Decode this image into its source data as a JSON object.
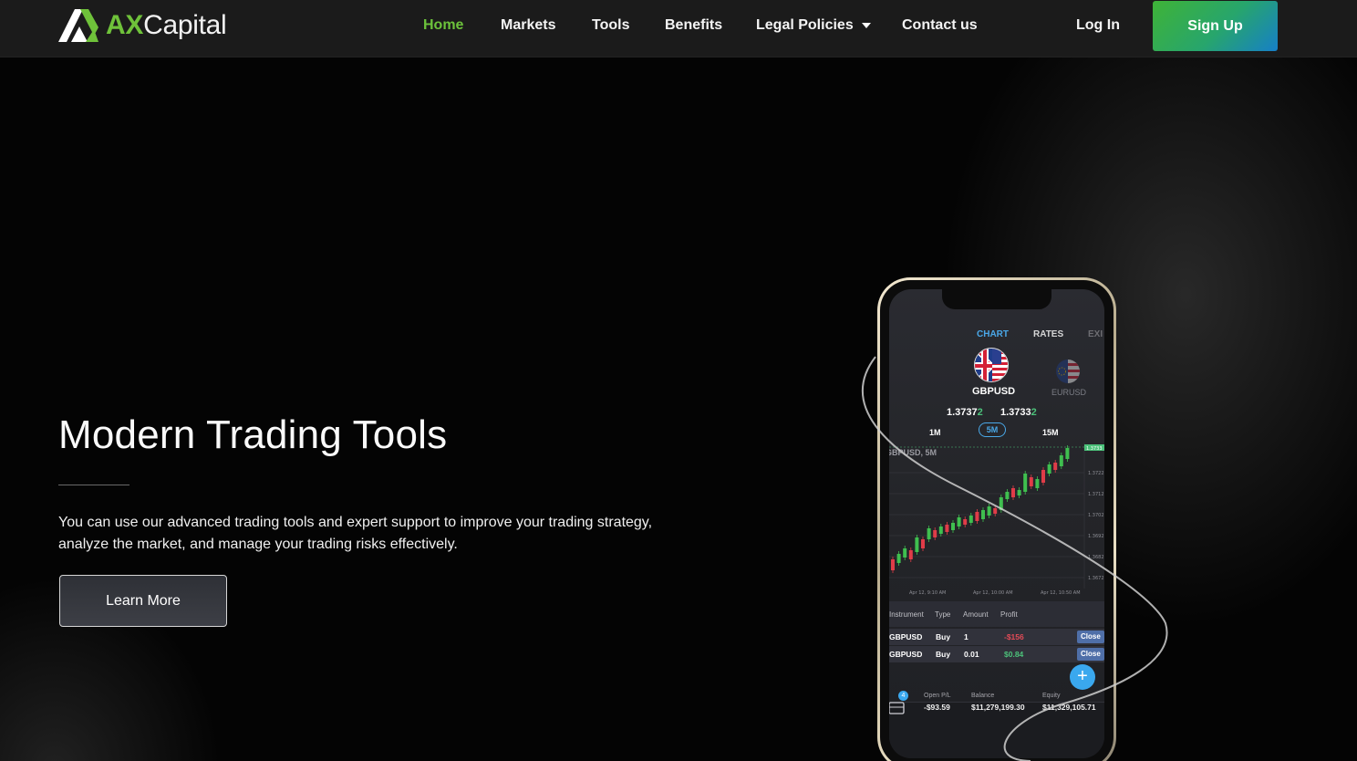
{
  "brand": {
    "name_accent": "AX",
    "name_rest": "Capital",
    "accent_color": "#6fc23a"
  },
  "nav": {
    "items": [
      {
        "label": "Home",
        "active": true
      },
      {
        "label": "Markets",
        "active": false
      },
      {
        "label": "Tools",
        "active": false
      },
      {
        "label": "Benefits",
        "active": false
      },
      {
        "label": "Legal Policies",
        "active": false,
        "dropdown": true
      },
      {
        "label": "Contact us",
        "active": false
      }
    ],
    "login_label": "Log In",
    "signup_label": "Sign Up"
  },
  "hero": {
    "title": "Modern Trading Tools",
    "description": "You can use our advanced trading tools and expert support to improve your trading strategy, analyze the market, and manage your trading risks effectively.",
    "cta_label": "Learn More"
  },
  "phone": {
    "tabs": [
      "CHART",
      "RATES",
      "EXI"
    ],
    "primary_pair": "GBPUSD",
    "secondary_pair": "EURUSD",
    "bid_main": "1.3737",
    "bid_pip": "2",
    "ask_main": "1.3733",
    "ask_pip": "2",
    "timeframes": [
      "1M",
      "5M",
      "15M"
    ],
    "active_timeframe": "5M",
    "chart_title": "GBPUSD, 5M",
    "price_levels": [
      "1.3733",
      "1.3722",
      "1.3712",
      "1.3702",
      "1.3692",
      "1.3682",
      "1.3672"
    ],
    "time_labels": [
      "Apr 12, 9:10 AM",
      "Apr 12, 10:00 AM",
      "Apr 12, 10:50 AM"
    ],
    "table": {
      "headers": [
        "Instrument",
        "Type",
        "Amount",
        "Profit"
      ],
      "rows": [
        {
          "instrument": "GBPUSD",
          "type": "Buy",
          "amount": "1",
          "profit": "-$156",
          "action": "Close"
        },
        {
          "instrument": "GBPUSD",
          "type": "Buy",
          "amount": "0.01",
          "profit": "$0.84",
          "action": "Close"
        }
      ]
    },
    "footer": {
      "badge_count": "4",
      "open_pl_label": "Open P/L",
      "open_pl_value": "-$93.59",
      "balance_label": "Balance",
      "balance_value": "$11,279,199.30",
      "equity_label": "Equity",
      "equity_value": "$11,329,105.71"
    }
  }
}
